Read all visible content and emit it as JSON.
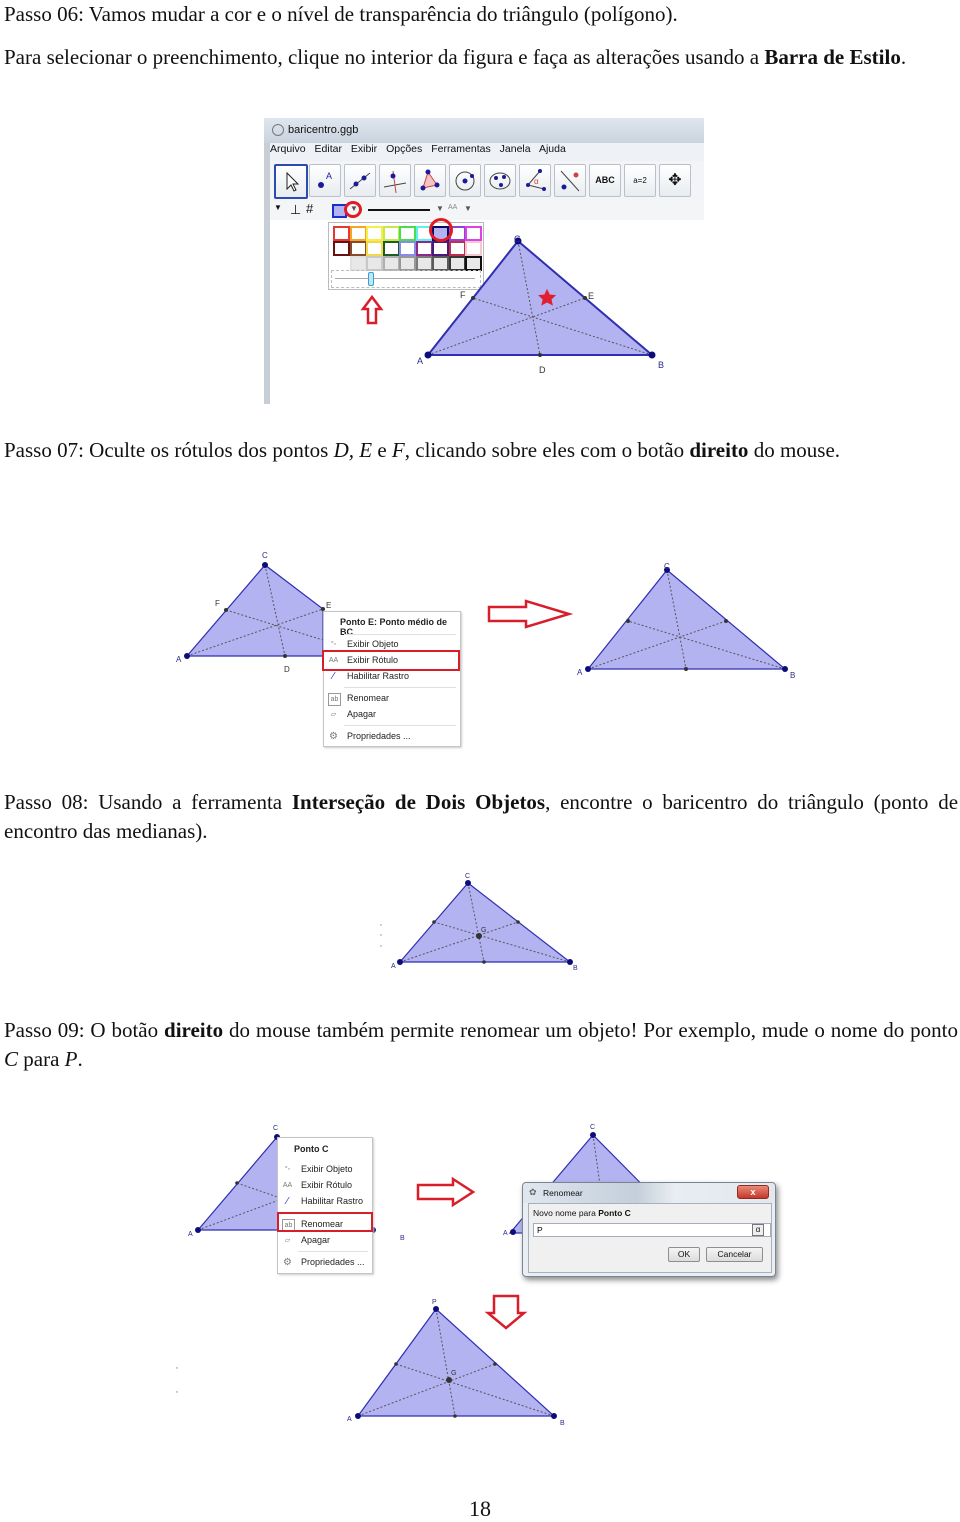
{
  "steps": {
    "s06": {
      "title_line": "Passo 06: Vamos mudar a cor e o nível de transparência do triângulo (polígono).",
      "line2_prefix": "Para selecionar o preenchimento, clique no interior da figura e faça as alterações usando a",
      "line2_bold": "Barra de Estilo",
      "line2_suffix": "."
    },
    "s07": {
      "prefix": "Passo 07: Oculte os rótulos dos pontos ",
      "math": "D, E",
      "mid": " e ",
      "math2": "F",
      "mid2": ", clicando sobre eles com o botão ",
      "bold": "direito",
      "suffix": " do mouse."
    },
    "s08": {
      "prefix": "Passo 08: Usando a ferramenta ",
      "bold": "Interseção de Dois Objetos",
      "suffix": ", encontre o baricentro do triângulo (ponto de encontro das medianas)."
    },
    "s09": {
      "prefix": "Passo 09: O botão ",
      "bold": "direito",
      "mid": " do mouse também permite renomear um objeto! Por exemplo, mude o nome do ponto ",
      "math": "C",
      "mid2": " para ",
      "math2": "P",
      "suffix": "."
    }
  },
  "geogebra_window": {
    "title": "baricentro.ggb",
    "menu": [
      "Arquivo",
      "Editar",
      "Exibir",
      "Opções",
      "Ferramentas",
      "Janela",
      "Ajuda"
    ],
    "tools": [
      "move-tool",
      "point-tool",
      "line-tool",
      "perpendicular-tool",
      "polygon-tool",
      "circle-tool",
      "conic-tool",
      "angle-tool",
      "reflect-tool",
      "text-tool",
      "slider-tool",
      "move-view-tool"
    ],
    "tool_labels": {
      "text": "ABC",
      "slider": "a=2"
    },
    "style_font_label": "AA",
    "palette": {
      "row1": [
        "#e53935",
        "#f5a623",
        "#f4f04a",
        "#c7e84a",
        "#4ddc4d",
        "#5ef0f0",
        "#0a0a60",
        "#8e44d8",
        "#e040e8"
      ],
      "row2": [
        "#6b1010",
        "#8a4a2a",
        "#f2d84a",
        "#1b5e20",
        "#8a8ae8",
        "#8a2a8a",
        "#4a1a7a",
        "#c0304a",
        "#f4c8d0"
      ],
      "row3": [
        "#ffffff",
        "#e0e0e0",
        "#c8c8c8",
        "#b0b0b0",
        "#989898",
        "#7a7a7a",
        "#5a5a5a",
        "#3a3a3a",
        "#101010"
      ],
      "selected_index": 6,
      "transparency_fraction": 0.25
    },
    "points": {
      "A": "A",
      "B": "B",
      "C": "C",
      "D": "D",
      "E": "E",
      "F": "F"
    }
  },
  "figure2": {
    "left_points": {
      "A": "A",
      "C": "C",
      "D": "D",
      "E": "E",
      "F": "F"
    },
    "context_menu": {
      "header": "Ponto E: Ponto médio de BC",
      "items": [
        "Exibir Objeto",
        "Exibir Rótulo",
        "Habilitar Rastro",
        "Renomear",
        "Apagar",
        "Propriedades ..."
      ],
      "highlighted": "Exibir Rótulo"
    },
    "right_points": {
      "A": "A",
      "B": "B",
      "C": "C"
    }
  },
  "figure3": {
    "points": {
      "A": "A",
      "B": "B",
      "C": "C",
      "G": "G"
    }
  },
  "figure4": {
    "points": {
      "A": "A",
      "B": "B",
      "C": "C"
    },
    "context_menu": {
      "header": "Ponto C",
      "items": [
        "Exibir Objeto",
        "Exibir Rótulo",
        "Habilitar Rastro",
        "Renomear",
        "Apagar",
        "Propriedades ..."
      ],
      "highlighted": "Renomear"
    },
    "dialog_points": {
      "A": "A",
      "C": "C"
    },
    "dialog": {
      "title": "Renomear",
      "prompt_prefix": "Novo nome para ",
      "prompt_bold": "Ponto C",
      "input_value": "P",
      "alpha_button": "α",
      "ok": "OK",
      "cancel": "Cancelar",
      "close": "x"
    },
    "result_points": {
      "A": "A",
      "B": "B",
      "P": "P",
      "G": "G"
    }
  },
  "page_number": "18",
  "colors": {
    "triangle_fill": "#b3b3f2",
    "triangle_edge": "#2f2fb0",
    "point": "#0d0d7a",
    "highlight_red": "#d81e2a"
  }
}
